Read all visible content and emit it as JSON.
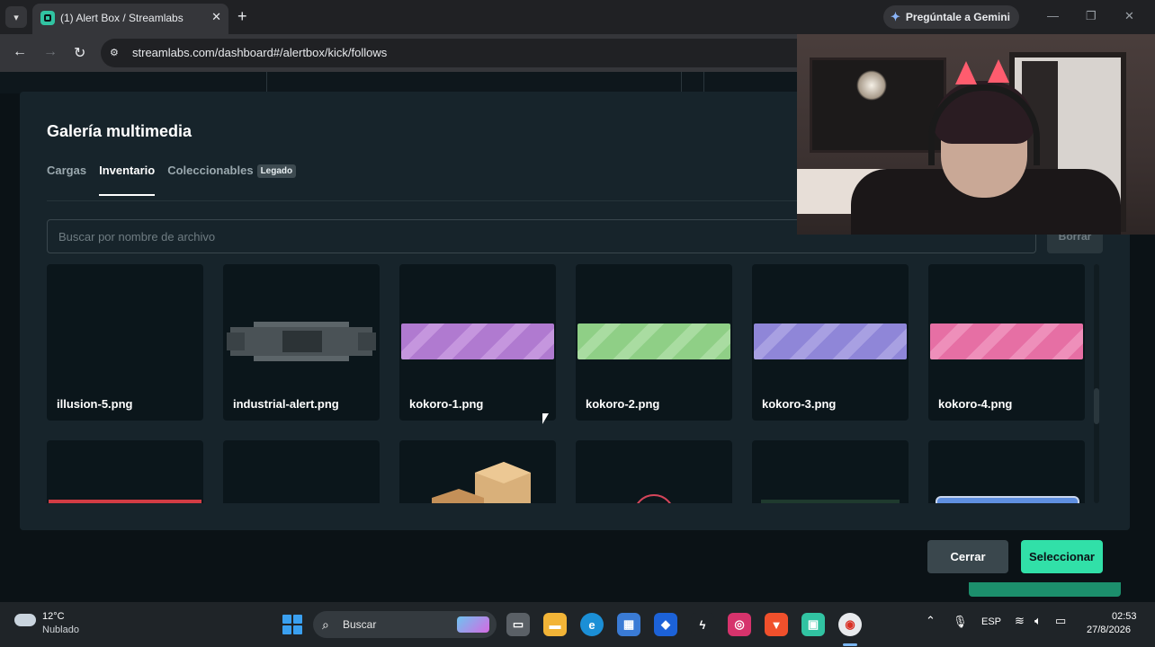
{
  "browser": {
    "tab_title": "(1) Alert Box / Streamlabs",
    "tab_close": "✕",
    "new_tab": "+",
    "menu_icon": "chevron-down-icon",
    "gemini_label": "Pregúntale a Gemini",
    "url": "streamlabs.com/dashboard#/alertbox/kick/follows",
    "window_controls": [
      "—",
      "❐",
      "✕"
    ]
  },
  "modal": {
    "title": "Galería multimedia",
    "tabs": [
      {
        "label": "Cargas",
        "active": false
      },
      {
        "label": "Inventario",
        "active": true
      },
      {
        "label": "Coleccionables",
        "active": false,
        "badge": "Legado"
      }
    ],
    "search_placeholder": "Buscar por nombre de archivo",
    "clear_label": "Borrar",
    "files_row1": [
      {
        "name": "illusion-5.png",
        "thumb": "empty"
      },
      {
        "name": "industrial-alert.png",
        "thumb": "industrial"
      },
      {
        "name": "kokoro-1.png",
        "thumb": "banner",
        "color": "#b07ad0"
      },
      {
        "name": "kokoro-2.png",
        "thumb": "banner",
        "color": "#8fcf86"
      },
      {
        "name": "kokoro-3.png",
        "thumb": "banner",
        "color": "#8f86d8"
      },
      {
        "name": "kokoro-4.png",
        "thumb": "banner",
        "color": "#e66fa4"
      }
    ],
    "files_row2": [
      {
        "thumb": "red-strip"
      },
      {
        "thumb": "empty"
      },
      {
        "thumb": "boxes"
      },
      {
        "thumb": "ring"
      },
      {
        "thumb": "dark-green"
      },
      {
        "thumb": "blue-bar"
      }
    ],
    "cancel_label": "Cerrar",
    "select_label": "Seleccionar"
  },
  "taskbar": {
    "weather_temp": "12°C",
    "weather_desc": "Nublado",
    "search_label": "Buscar",
    "language": "ESP",
    "time": "02:53",
    "date": "27/8/2026"
  },
  "colors": {
    "accent": "#31e0a8",
    "modal_bg": "#17242b",
    "card_bg": "#0b161b"
  }
}
